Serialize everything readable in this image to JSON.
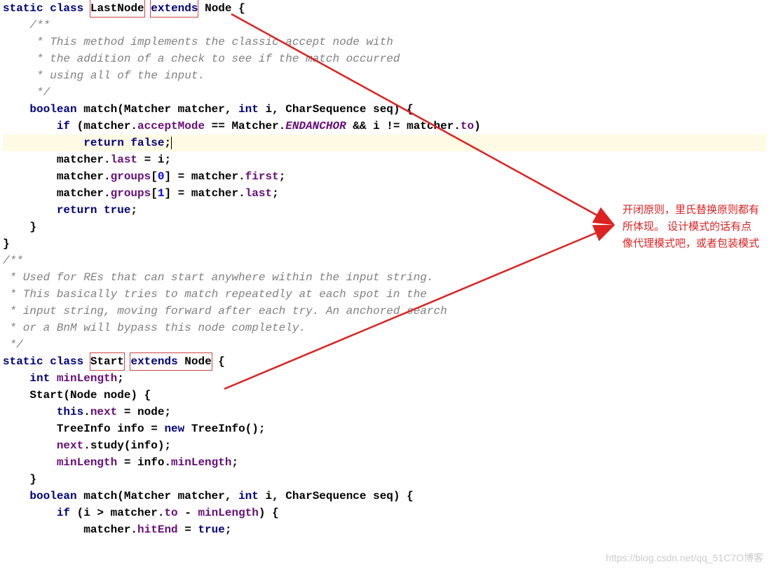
{
  "code": {
    "l1_a": "static",
    "l1_b": "class",
    "l1_c": "LastNode",
    "l1_d": "extends",
    "l1_e": "Node {",
    "l2": "    /**",
    "l3": "     * This method implements the classic accept node with",
    "l4": "     * the addition of a check to see if the match occurred",
    "l5": "     * using all of the input.",
    "l6": "     */",
    "l7_a": "    boolean",
    "l7_b": " match(Matcher matcher, ",
    "l7_c": "int",
    "l7_d": " i, CharSequence seq) {",
    "l8_a": "        if",
    "l8_b": " (matcher.",
    "l8_c": "acceptMode",
    "l8_d": " == Matcher.",
    "l8_e": "ENDANCHOR",
    "l8_f": " && i != matcher.",
    "l8_g": "to",
    "l8_h": ")",
    "l9_a": "            return false",
    "l9_b": ";",
    "l10_a": "        matcher.",
    "l10_b": "last",
    "l10_c": " = i;",
    "l11_a": "        matcher.",
    "l11_b": "groups",
    "l11_c": "[",
    "l11_d": "0",
    "l11_e": "] = matcher.",
    "l11_f": "first",
    "l11_g": ";",
    "l12_a": "        matcher.",
    "l12_b": "groups",
    "l12_c": "[",
    "l12_d": "1",
    "l12_e": "] = matcher.",
    "l12_f": "last",
    "l12_g": ";",
    "l13_a": "        return true",
    "l13_b": ";",
    "l14": "    }",
    "l15": "}",
    "l16": "",
    "l17": "/**",
    "l18": " * Used for REs that can start anywhere within the input string.",
    "l19": " * This basically tries to match repeatedly at each spot in the",
    "l20": " * input string, moving forward after each try. An anchored search",
    "l21": " * or a BnM will bypass this node completely.",
    "l22": " */",
    "l23_a": "static",
    "l23_b": "class",
    "l23_c": "Start",
    "l23_d": "extends",
    "l23_e": "Node",
    "l23_f": " {",
    "l24_a": "    int",
    "l24_b": "minLength",
    "l24_c": ";",
    "l25": "    Start(Node node) {",
    "l26_a": "        this",
    "l26_b": ".",
    "l26_c": "next",
    "l26_d": " = node;",
    "l27_a": "        TreeInfo info = ",
    "l27_b": "new",
    "l27_c": " TreeInfo();",
    "l28_a": "        ",
    "l28_b": "next",
    "l28_c": ".study(info);",
    "l29_a": "        ",
    "l29_b": "minLength",
    "l29_c": " = info.",
    "l29_d": "minLength",
    "l29_e": ";",
    "l30": "    }",
    "l31_a": "    boolean",
    "l31_b": " match(Matcher matcher, ",
    "l31_c": "int",
    "l31_d": " i, CharSequence seq) {",
    "l32_a": "        if",
    "l32_b": " (i > matcher.",
    "l32_c": "to",
    "l32_d": " - ",
    "l32_e": "minLength",
    "l32_f": ") {",
    "l33_a": "            matcher.",
    "l33_b": "hitEnd",
    "l33_c": " = ",
    "l33_d": "true",
    "l33_e": ";"
  },
  "annotation": {
    "line1": "开闭原则，里氏替换原则都有",
    "line2": "所体现。  设计模式的话有点",
    "line3": "像代理模式吧，或者包装模式"
  },
  "watermark": "https://blog.csdn.net/qq_51C7O博客"
}
